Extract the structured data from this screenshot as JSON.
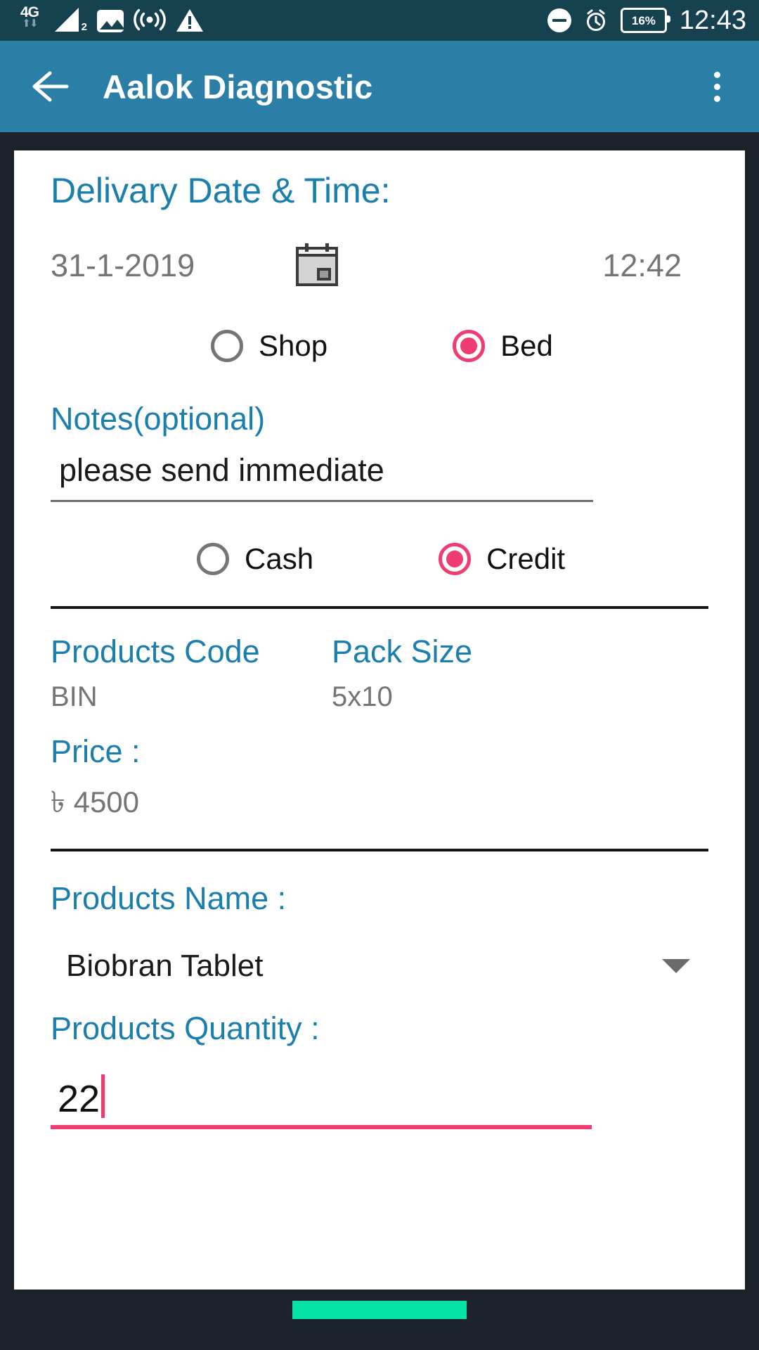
{
  "status_bar": {
    "network_type": "4G",
    "signal_sim": "2",
    "battery_percent": "16%",
    "clock": "12:43",
    "icons": [
      "4g-icon",
      "signal-icon",
      "image-icon",
      "cast-icon",
      "warning-icon",
      "do-not-disturb-icon",
      "alarm-icon",
      "battery-icon"
    ]
  },
  "app_bar": {
    "back_icon": "back-arrow-icon",
    "title": "Aalok Diagnostic",
    "overflow_icon": "overflow-menu-icon"
  },
  "form": {
    "delivery": {
      "label": "Delivary Date & Time:",
      "date": "31-1-2019",
      "calendar_icon": "calendar-icon",
      "time": "12:42"
    },
    "location_options": [
      {
        "label": "Shop",
        "selected": false
      },
      {
        "label": "Bed",
        "selected": true
      }
    ],
    "notes": {
      "label": "Notes(optional)",
      "value": "please send immediate",
      "placeholder": ""
    },
    "payment_options": [
      {
        "label": "Cash",
        "selected": false
      },
      {
        "label": "Credit",
        "selected": true
      }
    ],
    "products_code": {
      "label": "Products Code",
      "value": "BIN"
    },
    "pack_size": {
      "label": "Pack Size",
      "value": "5x10"
    },
    "price": {
      "label": "Price :",
      "value": "৳ 4500"
    },
    "products_name": {
      "label": "Products Name :",
      "value": "Biobran Tablet",
      "dropdown_icon": "chevron-down-icon"
    },
    "products_quantity": {
      "label": "Products Quantity :",
      "value": "22",
      "placeholder": ""
    }
  },
  "nav_pill": {
    "name": "home-indicator"
  },
  "colors": {
    "status_bar_bg": "#16414f",
    "app_bar_bg": "#2b7fa6",
    "page_bg": "#1b2229",
    "card_bg": "#ffffff",
    "accent_blue": "#1b7fae",
    "accent_pink": "#ee3d73",
    "nav_pill_green": "#06e2a4",
    "muted_text": "#757575"
  }
}
